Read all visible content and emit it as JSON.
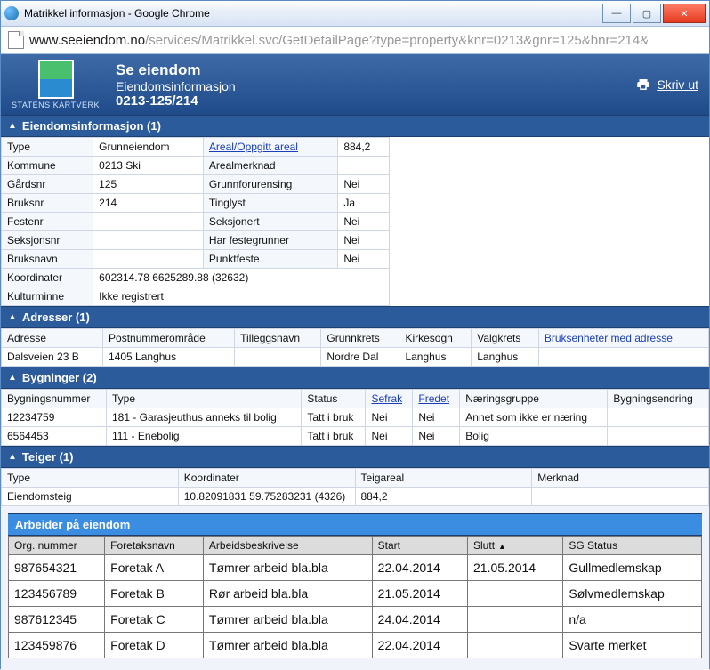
{
  "window": {
    "title": "Matrikkel informasjon - Google Chrome"
  },
  "url": {
    "host": "www.seeiendom.no",
    "path": "/services/Matrikkel.svc/GetDetailPage?type=property&knr=0213&gnr=125&bnr=214&"
  },
  "header": {
    "brand_small": "STATENS KARTVERK",
    "line1": "Se eiendom",
    "line2": "Eiendomsinformasjon",
    "line3": "0213-125/214",
    "print": "Skriv ut"
  },
  "sections": {
    "eiendom_title": "Eiendomsinformasjon (1)",
    "adresser_title": "Adresser (1)",
    "bygninger_title": "Bygninger (2)",
    "teiger_title": "Teiger (1)",
    "arbeider_title": "Arbeider på eiendom"
  },
  "eiendom": {
    "left": [
      {
        "k": "Type",
        "v": "Grunneiendom"
      },
      {
        "k": "Kommune",
        "v": "0213 Ski"
      },
      {
        "k": "Gårdsnr",
        "v": "125"
      },
      {
        "k": "Bruksnr",
        "v": "214"
      },
      {
        "k": "Festenr",
        "v": ""
      },
      {
        "k": "Seksjonsnr",
        "v": ""
      },
      {
        "k": "Bruksnavn",
        "v": ""
      },
      {
        "k": "Koordinater",
        "v": "602314.78 6625289.88 (32632)"
      },
      {
        "k": "Kulturminne",
        "v": "Ikke registrert"
      }
    ],
    "right": [
      {
        "k": "Areal/Oppgitt areal",
        "v": "884,2",
        "link": true
      },
      {
        "k": "Arealmerknad",
        "v": ""
      },
      {
        "k": "Grunnforurensing",
        "v": "Nei"
      },
      {
        "k": "Tinglyst",
        "v": "Ja"
      },
      {
        "k": "Seksjonert",
        "v": "Nei"
      },
      {
        "k": "Har festegrunner",
        "v": "Nei"
      },
      {
        "k": "Punktfeste",
        "v": "Nei"
      }
    ]
  },
  "adresser": {
    "headers": [
      "Adresse",
      "Postnummerområde",
      "Tilleggsnavn",
      "Grunnkrets",
      "Kirkesogn",
      "Valgkrets"
    ],
    "link_header": "Bruksenheter med adresse",
    "rows": [
      [
        "Dalsveien 23 B",
        "1405 Langhus",
        "",
        "Nordre Dal",
        "Langhus",
        "Langhus",
        ""
      ]
    ]
  },
  "bygninger": {
    "headers": [
      "Bygningsnummer",
      "Type",
      "Status",
      "Sefrak",
      "Fredet",
      "Næringsgruppe",
      "Bygningsendring"
    ],
    "link_cols": [
      3,
      4
    ],
    "rows": [
      [
        "12234759",
        "181 - Garasjeuthus anneks til bolig",
        "Tatt i bruk",
        "Nei",
        "Nei",
        "Annet som ikke er næring",
        ""
      ],
      [
        "6564453",
        "111 - Enebolig",
        "Tatt i bruk",
        "Nei",
        "Nei",
        "Bolig",
        ""
      ]
    ]
  },
  "teiger": {
    "headers": [
      "Type",
      "Koordinater",
      "Teigareal",
      "Merknad"
    ],
    "rows": [
      [
        "Eiendomsteig",
        "10.82091831 59.75283231 (4326)",
        "884,2",
        ""
      ]
    ]
  },
  "arbeider": {
    "headers": [
      "Org. nummer",
      "Foretaksnavn",
      "Arbeidsbeskrivelse",
      "Start",
      "Slutt",
      "SG Status"
    ],
    "sort_col": 4,
    "rows": [
      [
        "987654321",
        "Foretak A",
        "Tømrer arbeid bla.bla",
        "22.04.2014",
        "21.05.2014",
        "Gullmedlemskap"
      ],
      [
        "123456789",
        "Foretak B",
        "Rør arbeid bla.bla",
        "21.05.2014",
        "",
        "Sølvmedlemskap"
      ],
      [
        "987612345",
        "Foretak C",
        "Tømrer arbeid bla.bla",
        "24.04.2014",
        "",
        "n/a"
      ],
      [
        "123459876",
        "Foretak D",
        "Tømrer arbeid bla.bla",
        "22.04.2014",
        "",
        "Svarte merket"
      ]
    ]
  }
}
